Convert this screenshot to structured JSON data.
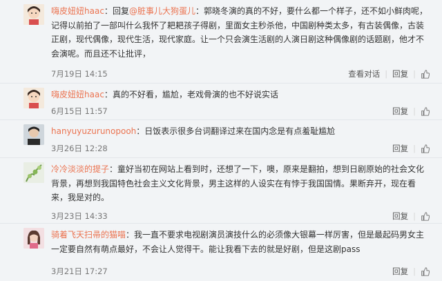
{
  "comments": [
    {
      "username": "嗨皮妞妞haac",
      "colon": "：",
      "text_before": "回复",
      "mention": "@脏事儿大狗蛋儿",
      "text_after": "：郭晓冬演的真的不好，要什么都一个样子，还不如小鲜肉呢，记得以前拍了一部叫什么我怀了耙耙孩子得剧，里面女主秒杀他，中国剧种类太多，有古装偶像，古装正剧，现代偶像，现代生活，现代家庭。让一个只会演生活剧的人演日剧这种偶像剧的话题剧，他才不会演呢。而且还不让批评，",
      "time": "7月19日 14:15",
      "view_conversation": "查看对话",
      "reply": "回复",
      "avatar": "girl-cartoon-avatar"
    },
    {
      "username": "嗨皮妞妞haac",
      "colon": "：",
      "text": "真的不好看，尴尬，老戏骨演的也不好说实话",
      "time": "6月15日 11:57",
      "reply": "回复",
      "avatar": "girl-cartoon-avatar"
    },
    {
      "username": "hanyuyuzurunopooh",
      "colon": "：",
      "text": "日饭表示很多台词翻译过来在国内念是有点羞耻尴尬",
      "time": "3月26日 12:28",
      "reply": "回复",
      "avatar": "photo-avatar"
    },
    {
      "username": "冷冷淡淡的提子",
      "colon": "：",
      "text": "童好当初在网站上看到时，还想了一下，噢，原来是翻拍，想到日剧原始的社会文化背景，再想到我国特色社会主义文化背景，男主这样的人设实在有悖于我国国情。果断弃开，现在看来，我是对的。",
      "time": "3月23日 14:33",
      "reply": "回复",
      "avatar": "plant-avatar"
    },
    {
      "username": "骑着飞天扫帚的猫喵",
      "colon": "：",
      "text": "我一直不要求电视剧演员演技什么的必须像大银幕一样厉害，但是最起码男女主一定要自然有萌点最好，不会让人觉得干。能让我看下去的就是好剧，但是这剧pass",
      "time": "3月21日 17:27",
      "reply": "回复",
      "avatar": "girl-photo-avatar"
    }
  ],
  "colors": {
    "username": "#eb7350",
    "text": "#333333",
    "meta": "#777777",
    "background": "#f2f4f6"
  }
}
